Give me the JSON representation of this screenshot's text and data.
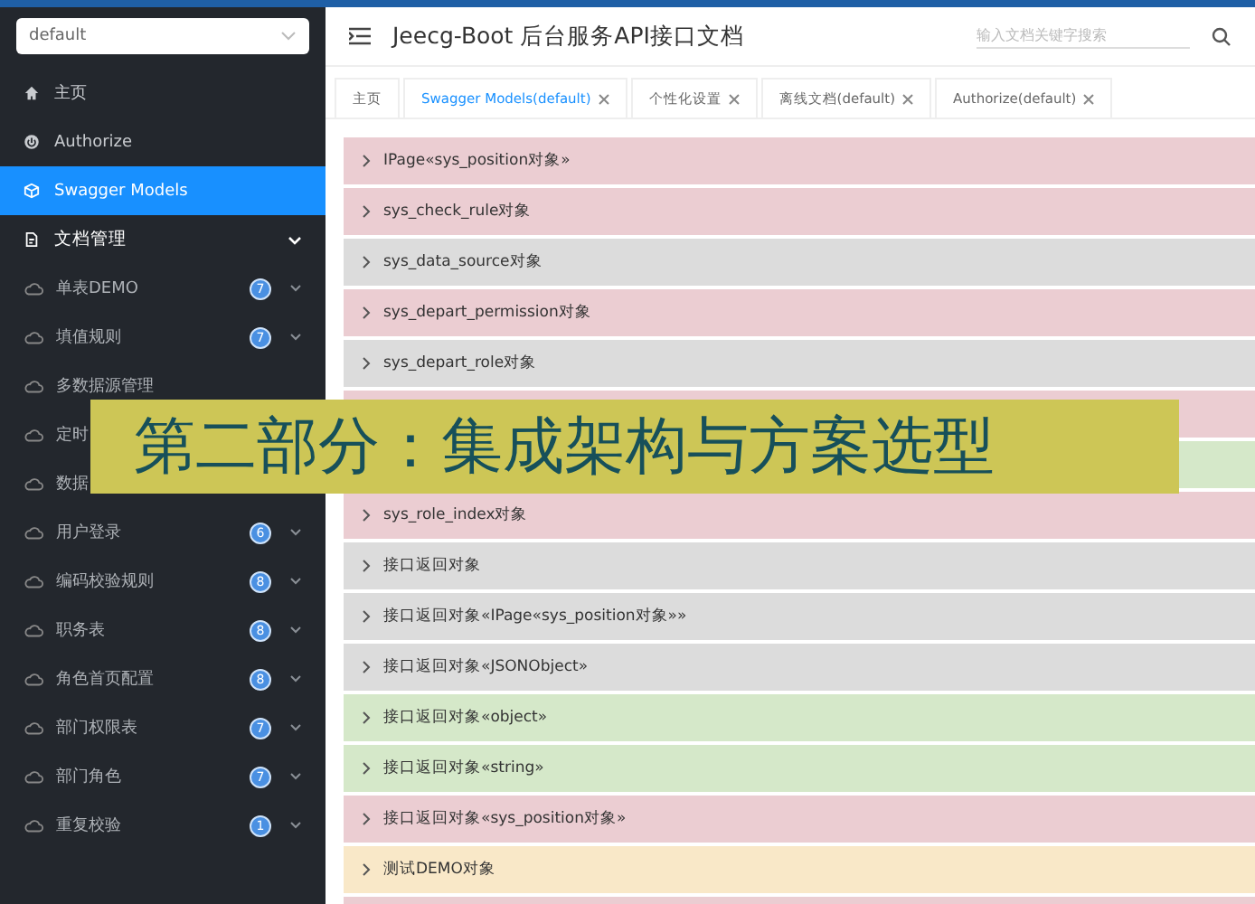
{
  "sidebar": {
    "group_select": {
      "value": "default"
    },
    "items": [
      {
        "label": "主页",
        "selected": false
      },
      {
        "label": "Authorize",
        "selected": false
      },
      {
        "label": "Swagger Models",
        "selected": true
      },
      {
        "label": "文档管理",
        "selected": false,
        "expanded": true,
        "children": [
          {
            "label": "单表DEMO",
            "badge": "7"
          },
          {
            "label": "填值规则",
            "badge": "7"
          },
          {
            "label": "多数据源管理"
          },
          {
            "label": "定时"
          },
          {
            "label": "数据"
          },
          {
            "label": "用户登录",
            "badge": "6"
          },
          {
            "label": "编码校验规则",
            "badge": "8"
          },
          {
            "label": "职务表",
            "badge": "8"
          },
          {
            "label": "角色首页配置",
            "badge": "8"
          },
          {
            "label": "部门权限表",
            "badge": "7"
          },
          {
            "label": "部门角色",
            "badge": "7"
          },
          {
            "label": "重复校验",
            "badge": "1"
          }
        ]
      }
    ]
  },
  "header": {
    "title": "Jeecg-Boot 后台服务API接口文档",
    "search": {
      "placeholder": "输入文档关键字搜索"
    }
  },
  "tabs": [
    {
      "label": "主页",
      "selected": false,
      "closable": false
    },
    {
      "label": "Swagger Models(default)",
      "selected": true,
      "closable": true
    },
    {
      "label": "个性化设置",
      "selected": false,
      "closable": true
    },
    {
      "label": "离线文档(default)",
      "selected": false,
      "closable": true
    },
    {
      "label": "Authorize(default)",
      "selected": false,
      "closable": true
    }
  ],
  "models": [
    {
      "label": "IPage«sys_position对象»",
      "color": "#ebcdd2"
    },
    {
      "label": "sys_check_rule对象",
      "color": "#ebcdd2"
    },
    {
      "label": "sys_data_source对象",
      "color": "#dcdcdc"
    },
    {
      "label": "sys_depart_permission对象",
      "color": "#ebcdd2"
    },
    {
      "label": "sys_depart_role对象",
      "color": "#dcdcdc"
    },
    {
      "color": "#ebcdd2"
    },
    {
      "color": "#d5e8c9"
    },
    {
      "label": "sys_role_index对象",
      "color": "#ebcdd2"
    },
    {
      "label": "接口返回对象",
      "color": "#dcdcdc"
    },
    {
      "label": "接口返回对象«IPage«sys_position对象»»",
      "color": "#dcdcdc"
    },
    {
      "label": "接口返回对象«JSONObject»",
      "color": "#dcdcdc"
    },
    {
      "label": "接口返回对象«object»",
      "color": "#d5e8c9"
    },
    {
      "label": "接口返回对象«string»",
      "color": "#d5e8c9"
    },
    {
      "label": "接口返回对象«sys_position对象»",
      "color": "#ebcdd2"
    },
    {
      "label": "测试DEMO对象",
      "color": "#f9e8c8"
    },
    {
      "color": "#ebcdd2"
    }
  ],
  "banner": {
    "text": "第二部分：集成架构与方案选型"
  }
}
